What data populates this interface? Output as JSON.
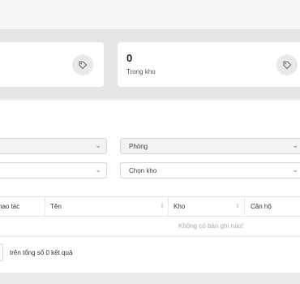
{
  "stats": {
    "left": {
      "icon": "tag-icon"
    },
    "right": {
      "value": "0",
      "label": "Trong kho",
      "icon": "tag-icon"
    }
  },
  "filters": {
    "row1": {
      "left_value": "",
      "right_value": "Phòng"
    },
    "row2": {
      "left_value": "",
      "right_value": "Chọn kho"
    }
  },
  "table": {
    "columns": [
      "hao tác",
      "Tên",
      "Kho",
      "Căn hộ"
    ],
    "empty_message": "Không có bản ghi nào!"
  },
  "pagination": {
    "summary": "trên tổng số 0 kết quả"
  },
  "colors": {
    "background": "#ececec",
    "card": "#ffffff",
    "empty_text": "#aaaaaa"
  }
}
